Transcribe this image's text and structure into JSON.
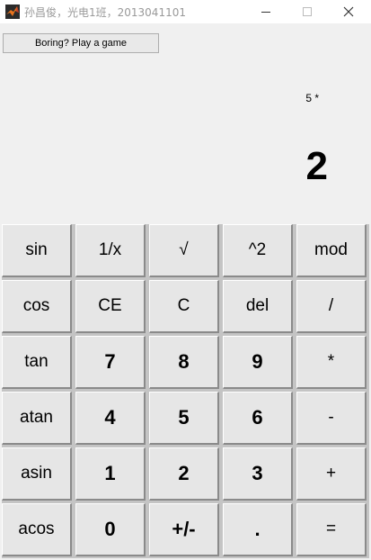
{
  "window": {
    "title": "孙昌俊，光电1班，2013041101"
  },
  "game_button": {
    "label": "Boring? Play a game"
  },
  "display": {
    "expression": "5 *",
    "result": "2"
  },
  "keys": [
    {
      "label": "sin",
      "name": "sin-key"
    },
    {
      "label": "1/x",
      "name": "reciprocal-key"
    },
    {
      "label": "√",
      "name": "sqrt-key"
    },
    {
      "label": "^2",
      "name": "square-key"
    },
    {
      "label": "mod",
      "name": "mod-key"
    },
    {
      "label": "cos",
      "name": "cos-key"
    },
    {
      "label": "CE",
      "name": "clear-entry-key"
    },
    {
      "label": "C",
      "name": "clear-key"
    },
    {
      "label": "del",
      "name": "delete-key"
    },
    {
      "label": "/",
      "name": "divide-key"
    },
    {
      "label": "tan",
      "name": "tan-key"
    },
    {
      "label": "7",
      "name": "digit-7-key"
    },
    {
      "label": "8",
      "name": "digit-8-key"
    },
    {
      "label": "9",
      "name": "digit-9-key"
    },
    {
      "label": "*",
      "name": "multiply-key"
    },
    {
      "label": "atan",
      "name": "atan-key"
    },
    {
      "label": "4",
      "name": "digit-4-key"
    },
    {
      "label": "5",
      "name": "digit-5-key"
    },
    {
      "label": "6",
      "name": "digit-6-key"
    },
    {
      "label": "-",
      "name": "subtract-key"
    },
    {
      "label": "asin",
      "name": "asin-key"
    },
    {
      "label": "1",
      "name": "digit-1-key"
    },
    {
      "label": "2",
      "name": "digit-2-key"
    },
    {
      "label": "3",
      "name": "digit-3-key"
    },
    {
      "label": "+",
      "name": "add-key"
    },
    {
      "label": "acos",
      "name": "acos-key"
    },
    {
      "label": "0",
      "name": "digit-0-key"
    },
    {
      "label": "+/-",
      "name": "negate-key"
    },
    {
      "label": ".",
      "name": "decimal-point-key"
    },
    {
      "label": "=",
      "name": "equals-key"
    }
  ]
}
